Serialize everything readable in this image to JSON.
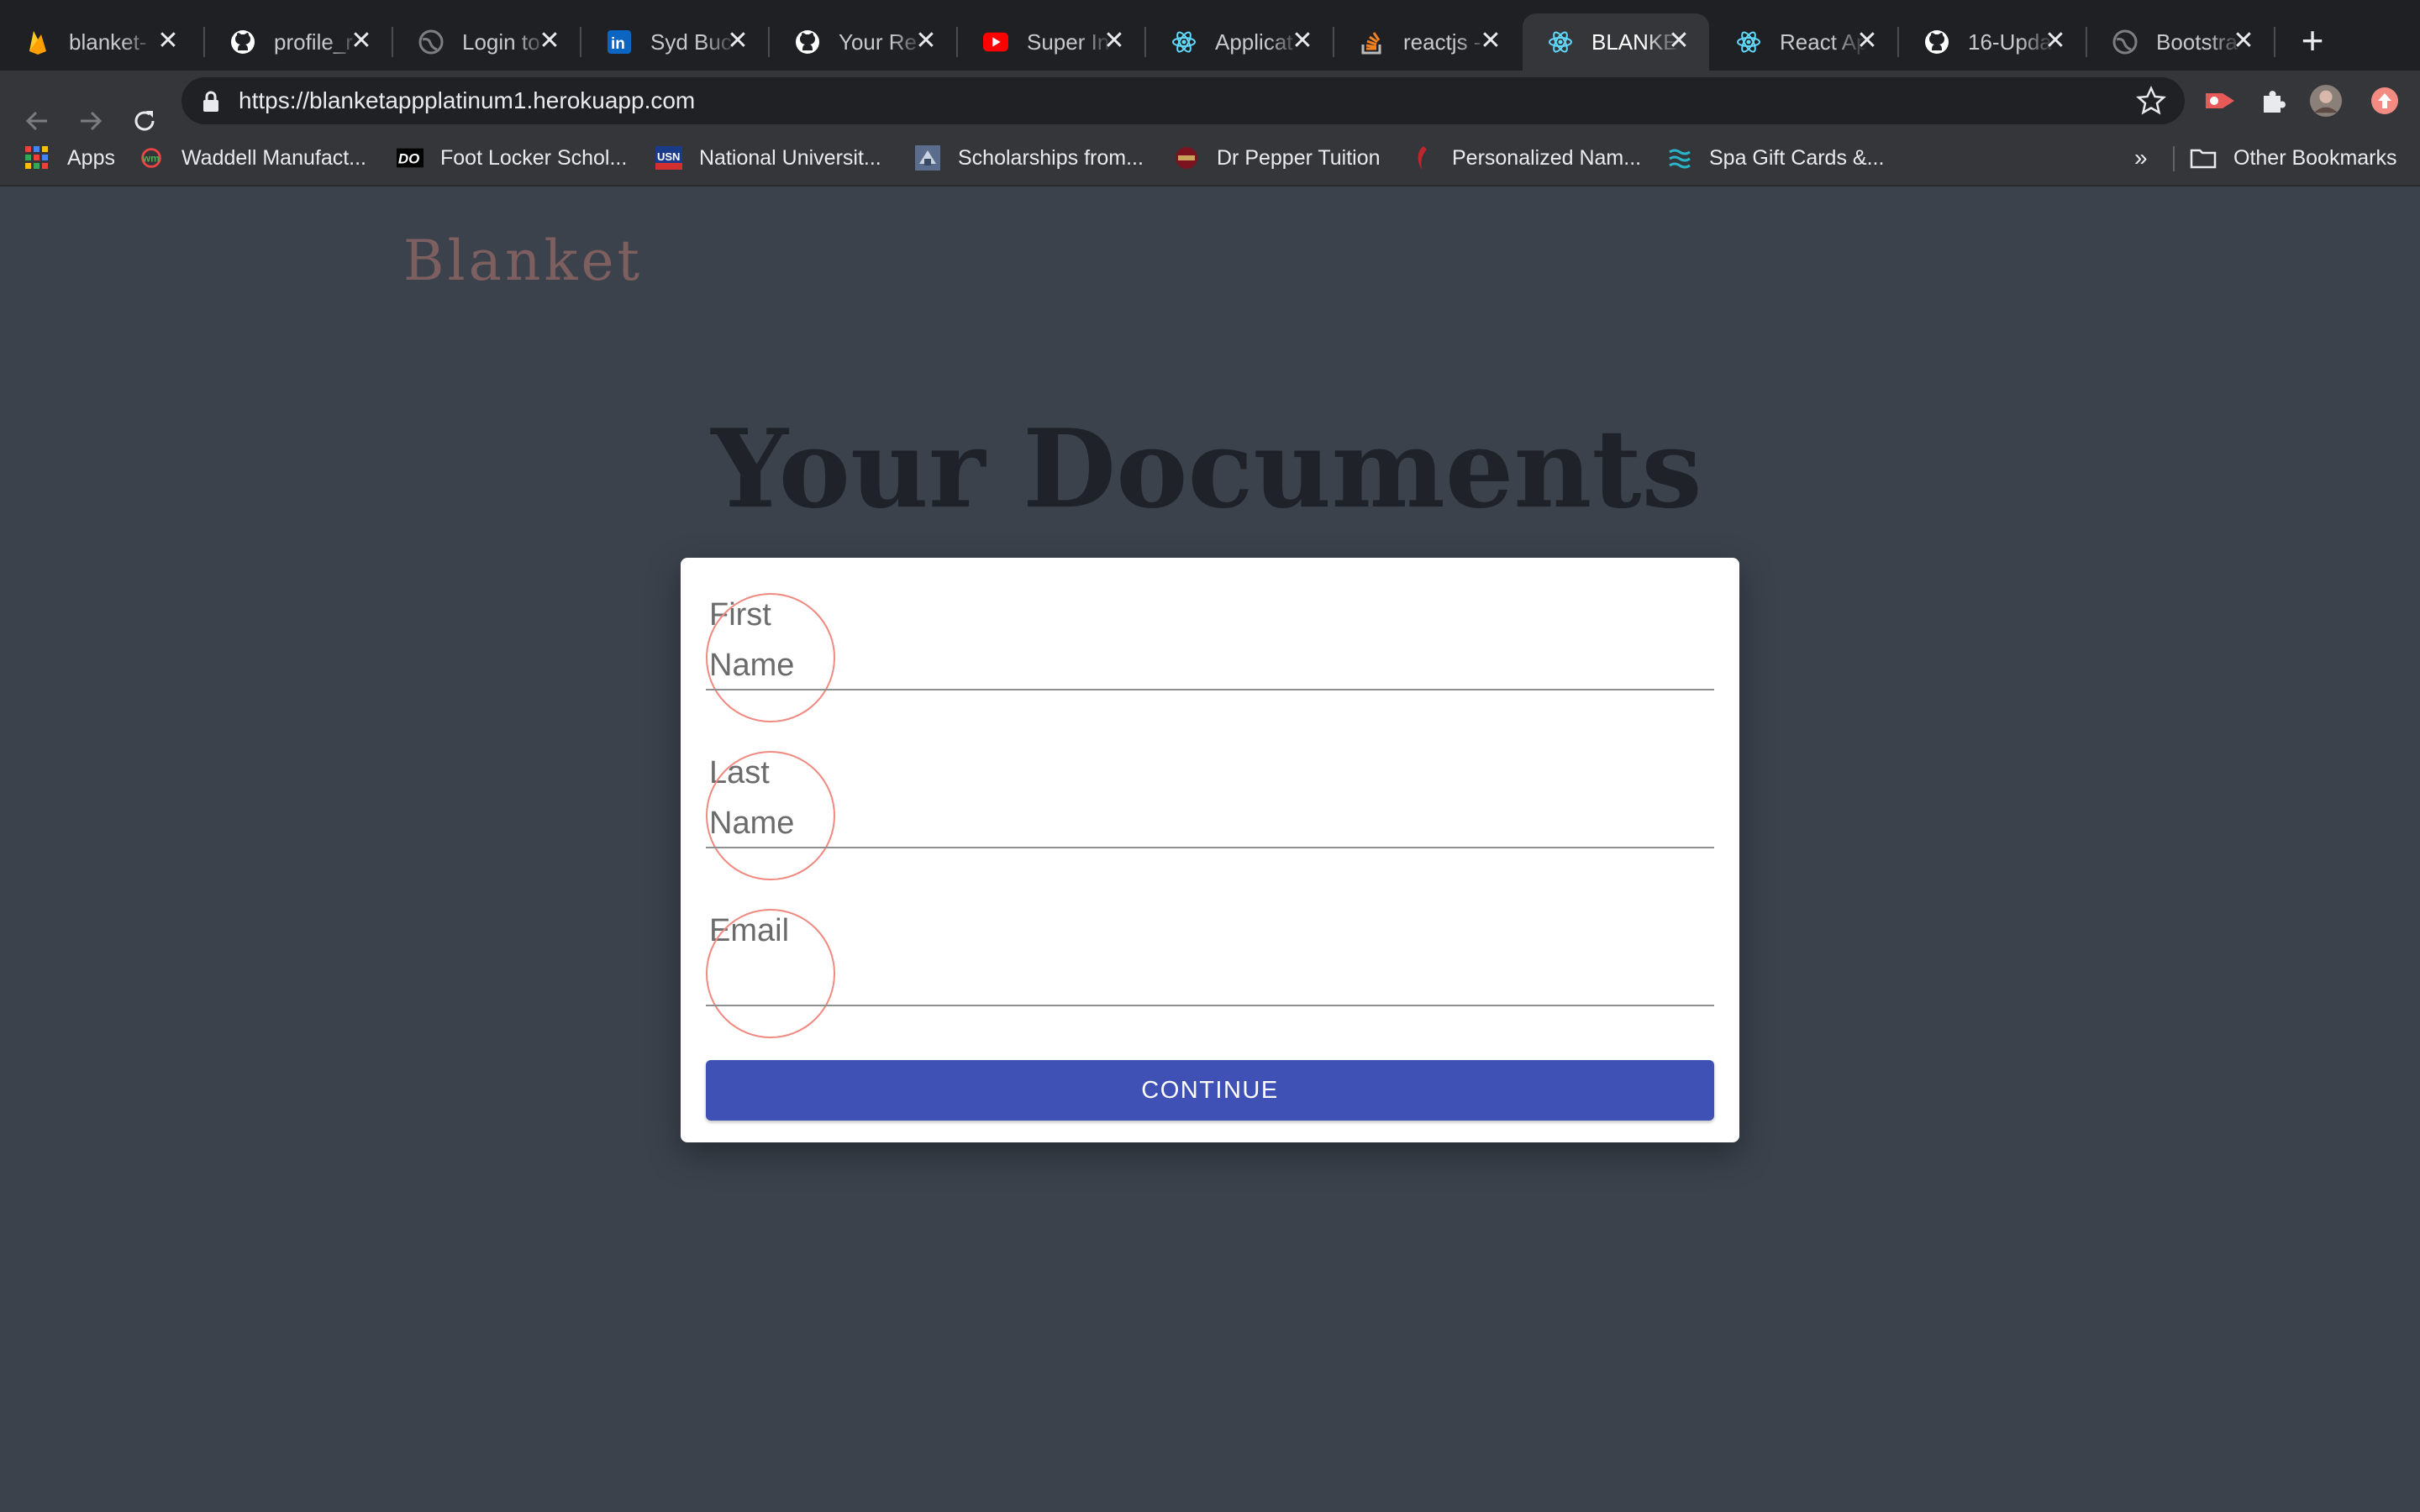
{
  "browser": {
    "tabs": [
      {
        "title": "blanket-",
        "favicon": "firebase-icon"
      },
      {
        "title": "profile_r",
        "favicon": "github-icon"
      },
      {
        "title": "Login to",
        "favicon": "globe-icon"
      },
      {
        "title": "Syd Buc",
        "favicon": "linkedin-icon"
      },
      {
        "title": "Your Re",
        "favicon": "github-icon"
      },
      {
        "title": "Super In",
        "favicon": "youtube-icon"
      },
      {
        "title": "Applicat",
        "favicon": "react-icon"
      },
      {
        "title": "reactjs -",
        "favicon": "stackoverflow-icon"
      },
      {
        "title": "BLANKE",
        "favicon": "react-icon",
        "active": true
      },
      {
        "title": "React Ap",
        "favicon": "react-icon"
      },
      {
        "title": "16-Upda",
        "favicon": "github-icon"
      },
      {
        "title": "Bootstra",
        "favicon": "globe-icon"
      }
    ],
    "new_tab_label": "+",
    "close_glyph": "✕",
    "url": "https://blanketappplatinum1.herokuapp.com",
    "bookmarks": [
      {
        "label": "Apps",
        "icon": "apps-grid-icon"
      },
      {
        "label": "Waddell Manufact...",
        "icon": "waddell-icon"
      },
      {
        "label": "Foot Locker Schol...",
        "icon": "footlocker-icon"
      },
      {
        "label": "National Universit...",
        "icon": "usn-icon"
      },
      {
        "label": "Scholarships from...",
        "icon": "scholarship-icon"
      },
      {
        "label": "Dr Pepper Tuition",
        "icon": "drpepper-icon"
      },
      {
        "label": "Personalized Nam...",
        "icon": "personalized-icon"
      },
      {
        "label": "Spa Gift Cards &...",
        "icon": "spa-icon"
      }
    ],
    "bookmarks_overflow": "»",
    "other_bookmarks": "Other Bookmarks"
  },
  "page": {
    "brand": "Blanket",
    "title": "Your Documents",
    "form": {
      "fields": [
        {
          "label": "First Name",
          "value": ""
        },
        {
          "label": "Last Name",
          "value": ""
        },
        {
          "label": "Email",
          "value": ""
        }
      ],
      "submit_label": "CONTINUE"
    }
  },
  "colors": {
    "page_background": "#3b424c",
    "brand_text": "#7d5f5f",
    "button_primary": "#3f51b5",
    "ripple": "#f08a80"
  }
}
